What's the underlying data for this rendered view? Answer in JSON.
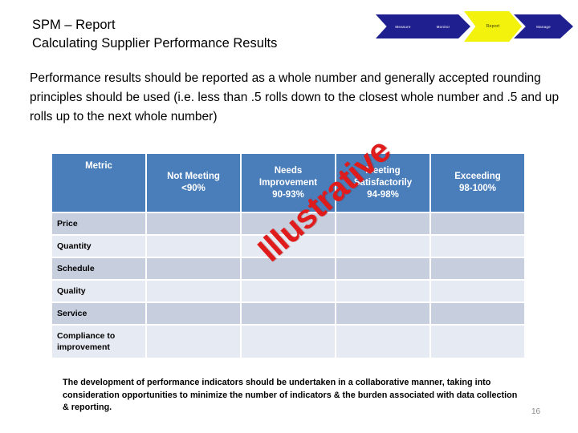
{
  "slide": {
    "title": "SPM – Report\nCalculating Supplier Performance Results",
    "number": "16"
  },
  "process_banner": {
    "steps": [
      {
        "label": "Measure",
        "state": "inactive"
      },
      {
        "label": "Monitor",
        "state": "inactive"
      },
      {
        "label": "Report",
        "state": "active"
      },
      {
        "label": "Manage",
        "state": "inactive"
      }
    ],
    "active_color": "#f2f20d",
    "inactive_color": "#1f1f8f"
  },
  "body": {
    "paragraph": "Performance results should be reported as a whole number and generally accepted rounding principles should be used (i.e. less than .5 rolls down to the closest whole number and .5 and  up rolls up to the next whole number)"
  },
  "table": {
    "header_color": "#4a7ebb",
    "band_a_color": "#c7cfdf",
    "band_b_color": "#e6eaf2",
    "columns": [
      {
        "line1": "Metric",
        "line2": "",
        "line3": ""
      },
      {
        "line1": "Not Meeting",
        "line2": "<90%",
        "line3": ""
      },
      {
        "line1": "Needs",
        "line2": "Improvement",
        "line3": "90-93%"
      },
      {
        "line1": "Meeting",
        "line2": "Satisfactorily",
        "line3": "94-98%"
      },
      {
        "line1": "Exceeding",
        "line2": "98-100%",
        "line3": ""
      }
    ],
    "rows": [
      {
        "label": "Price",
        "label2": ""
      },
      {
        "label": "Quantity",
        "label2": ""
      },
      {
        "label": "Schedule",
        "label2": ""
      },
      {
        "label": "Quality",
        "label2": ""
      },
      {
        "label": "Service",
        "label2": ""
      },
      {
        "label": "Compliance to",
        "label2": "improvement"
      }
    ]
  },
  "watermark": {
    "text": "Illustrative",
    "color": "#e01b1b"
  },
  "footer": {
    "note": "The  development of performance indicators should be undertaken in a collaborative manner, taking into consideration opportunities to minimize the number of indicators & the burden associated with data collection & reporting."
  }
}
